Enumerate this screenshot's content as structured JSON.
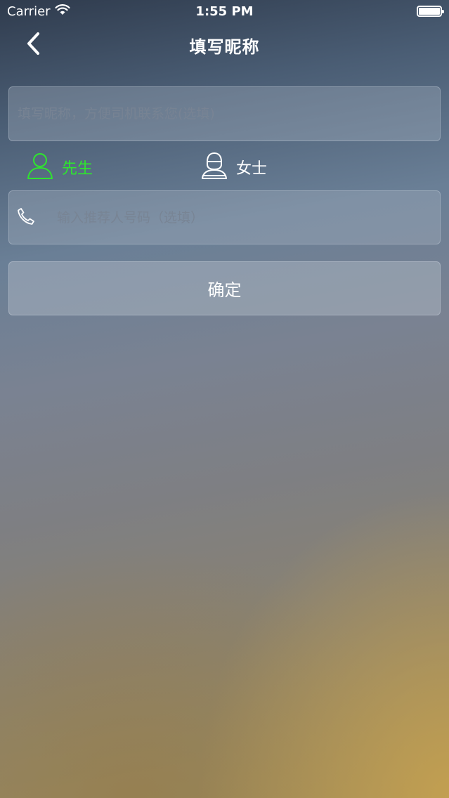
{
  "status_bar": {
    "carrier": "Carrier",
    "time": "1:55 PM",
    "wifi_icon": "wifi-icon",
    "battery_icon": "battery-icon"
  },
  "nav": {
    "title": "填写昵称",
    "back_icon": "chevron-left-icon"
  },
  "form": {
    "nickname_placeholder": "填写昵称，方便司机联系您(选填)",
    "gender": {
      "male_label": "先生",
      "female_label": "女士",
      "selected": "male",
      "selected_color": "#2ee62e",
      "male_icon": "user-icon",
      "female_icon": "female-user-icon"
    },
    "referrer_placeholder": "输入推荐人号码（选填）",
    "phone_icon": "phone-icon",
    "confirm_label": "确定"
  }
}
